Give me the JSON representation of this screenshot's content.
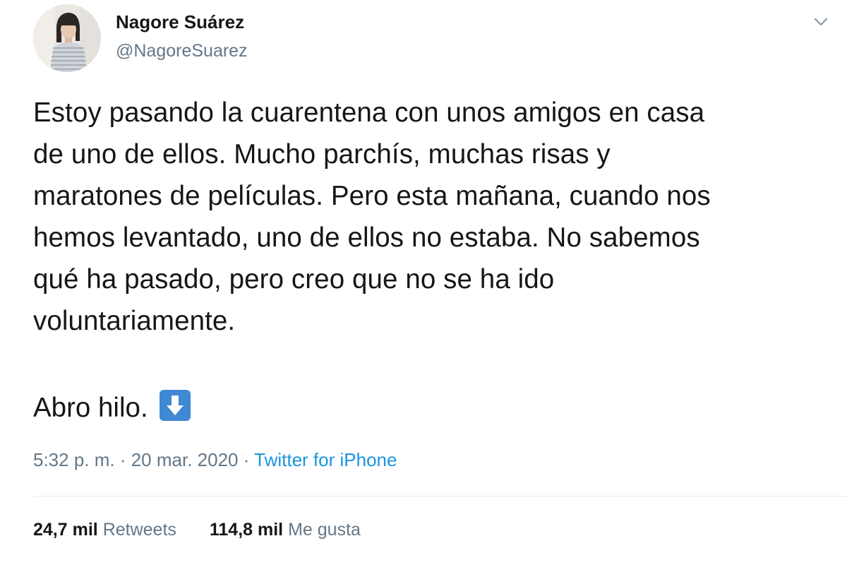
{
  "author": {
    "name": "Nagore Suárez",
    "handle": "@NagoreSuarez"
  },
  "tweet": {
    "lines": [
      "Estoy pasando la cuarentena con unos amigos en casa",
      "de uno de ellos. Mucho parchís, muchas risas y",
      "maratones de películas. Pero esta mañana, cuando nos",
      "hemos levantado, uno de ellos no estaba. No sabemos",
      "qué ha pasado, pero creo que no se ha ido",
      "voluntariamente."
    ],
    "thread_text": "Abro hilo.",
    "thread_emoji": "down-arrow-emoji"
  },
  "meta": {
    "timestamp": "5:32 p. m. · 20 mar. 2020 · ",
    "source": "Twitter for iPhone"
  },
  "stats": {
    "retweets_count": "24,7 mil",
    "retweets_label": "Retweets",
    "likes_count": "114,8 mil",
    "likes_label": "Me gusta"
  },
  "colors": {
    "text": "#14171a",
    "secondary": "#657786",
    "link": "#1b95e0",
    "emoji_blue": "#3f88d4"
  },
  "icons": {
    "more": "chevron-down-icon"
  }
}
